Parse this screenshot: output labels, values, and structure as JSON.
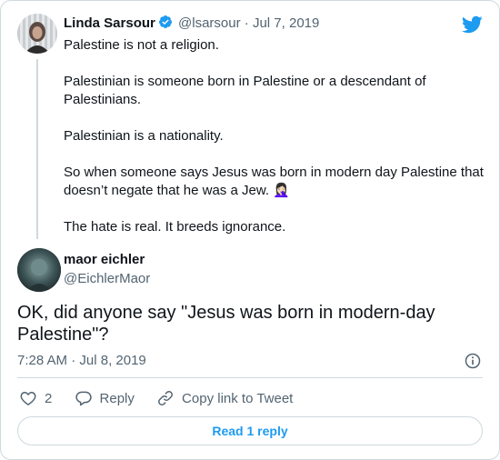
{
  "parent_tweet": {
    "author_name": "Linda Sarsour",
    "handle": "@lsarsour",
    "separator": "·",
    "date": "Jul 7, 2019",
    "paragraphs": [
      "Palestine is not a religion.",
      "Palestinian is someone born in Palestine or a descendant of Palestinians.",
      "Palestinian is a nationality.",
      "So when someone says Jesus was born in modern day Palestine that doesn’t negate that he was a Jew. 🤦🏻‍♀️",
      "The hate is real. It breeds ignorance."
    ]
  },
  "main_tweet": {
    "author_name": "maor eichler",
    "handle": "@EichlerMaor",
    "text": "OK, did anyone say \"Jesus was born in modern-day Palestine\"?",
    "time": "7:28 AM",
    "separator": "·",
    "date": "Jul 8, 2019"
  },
  "actions": {
    "like_count": "2",
    "reply_label": "Reply",
    "copy_link_label": "Copy link to Tweet"
  },
  "read_replies_label": "Read 1 reply",
  "colors": {
    "accent": "#1d9bf0",
    "text": "#0f1419",
    "secondary": "#536471",
    "border": "#cfd9de"
  },
  "icons": [
    "twitter-bird-icon",
    "verified-badge-icon",
    "info-icon",
    "heart-icon",
    "reply-icon",
    "link-icon"
  ]
}
